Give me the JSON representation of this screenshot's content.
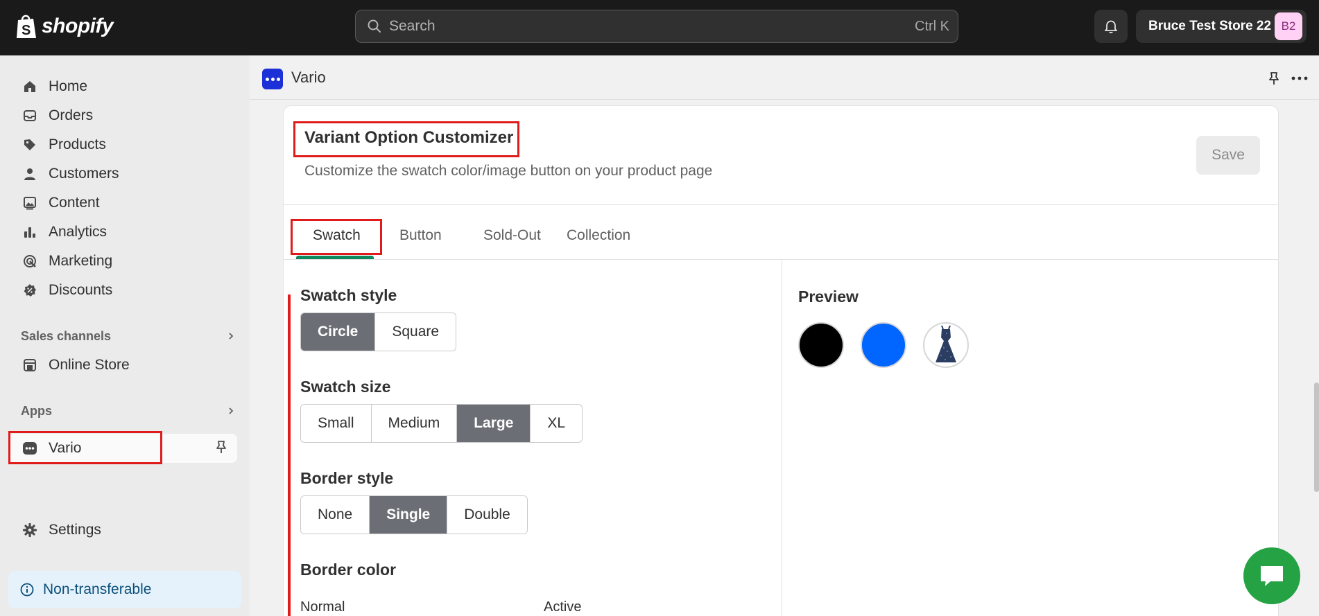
{
  "topbar": {
    "brand": "shopify",
    "search_placeholder": "Search",
    "search_shortcut": "Ctrl K",
    "store_name": "Bruce Test Store 22",
    "store_initials": "B2"
  },
  "sidebar": {
    "items": [
      {
        "label": "Home",
        "icon": "home-icon"
      },
      {
        "label": "Orders",
        "icon": "inbox-icon"
      },
      {
        "label": "Products",
        "icon": "tag-icon"
      },
      {
        "label": "Customers",
        "icon": "person-icon"
      },
      {
        "label": "Content",
        "icon": "image-icon"
      },
      {
        "label": "Analytics",
        "icon": "bar-chart-icon"
      },
      {
        "label": "Marketing",
        "icon": "target-icon"
      },
      {
        "label": "Discounts",
        "icon": "discount-icon"
      }
    ],
    "sales_channels_label": "Sales channels",
    "online_store_label": "Online Store",
    "apps_label": "Apps",
    "app_item_label": "Vario",
    "settings_label": "Settings",
    "non_transferable_label": "Non-transferable"
  },
  "appbar": {
    "app_name": "Vario"
  },
  "card": {
    "title": "Variant Option Customizer",
    "subtitle": "Customize the swatch color/image button on your product page",
    "save_label": "Save",
    "tabs": [
      "Swatch",
      "Button",
      "Sold-Out",
      "Collection"
    ],
    "active_tab": "Swatch",
    "swatch_style": {
      "label": "Swatch style",
      "options": [
        "Circle",
        "Square"
      ],
      "selected": "Circle"
    },
    "swatch_size": {
      "label": "Swatch size",
      "options": [
        "Small",
        "Medium",
        "Large",
        "XL"
      ],
      "selected": "Large"
    },
    "border_style": {
      "label": "Border style",
      "options": [
        "None",
        "Single",
        "Double"
      ],
      "selected": "Single"
    },
    "border_color": {
      "label": "Border color",
      "normal_label": "Normal",
      "active_label": "Active"
    },
    "preview": {
      "title": "Preview",
      "swatch_colors": [
        "#000000",
        "#0066ff"
      ]
    }
  },
  "colors": {
    "accent_green": "#0f8a5f",
    "selected_button": "#6b6f75",
    "annotation_red": "#e01b1b",
    "chat_green": "#25a244"
  }
}
